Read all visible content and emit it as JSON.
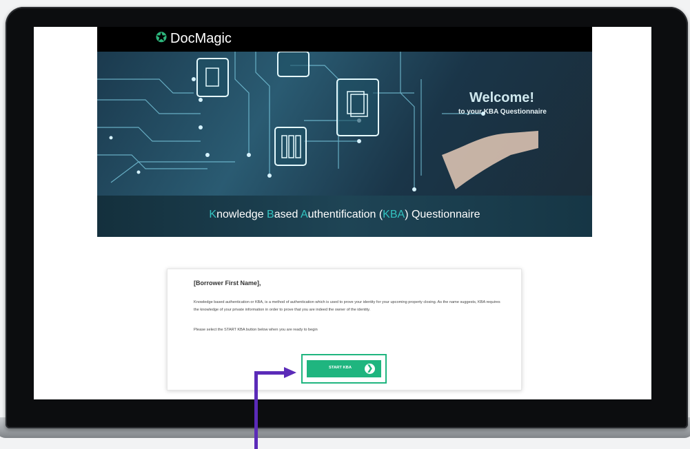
{
  "brand": {
    "name": "DocMagic",
    "logo_icon": "star-icon",
    "accent": "#2db67c"
  },
  "hero": {
    "welcome_title": "Welcome!",
    "welcome_subtitle": "to your KBA Questionnaire"
  },
  "banner": {
    "parts": [
      {
        "text": "K",
        "hl": true
      },
      {
        "text": "nowledge ",
        "hl": false
      },
      {
        "text": "B",
        "hl": true
      },
      {
        "text": "ased ",
        "hl": false
      },
      {
        "text": "A",
        "hl": true
      },
      {
        "text": "uthentification (",
        "hl": false
      },
      {
        "text": "KBA",
        "hl": true
      },
      {
        "text": ") Questionnaire",
        "hl": false
      }
    ]
  },
  "card": {
    "greeting": "[Borrower First Name],",
    "paragraph1": "Knowledge based authentication or KBA, is a method of authentication which is used to prove your identity for your upcoming property closing. As the name suggests, KBA requires the knowledge of your private information in order to prove that you are indeed the owner of the identity.",
    "paragraph2": "Please select the START KBA  button below when you are ready to begin",
    "button_label": "START KBA",
    "button_icon": "arrow-right-circle-icon",
    "button_color": "#1fb57f"
  },
  "annotation": {
    "color": "#5b2bb8"
  }
}
